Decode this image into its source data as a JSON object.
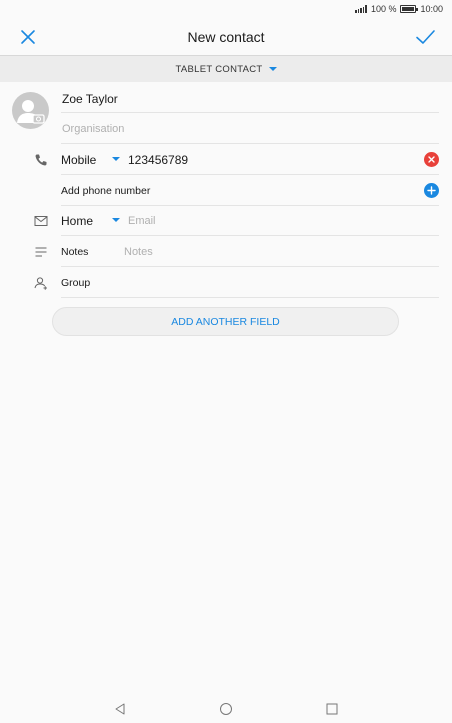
{
  "status_bar": {
    "battery": "100 %",
    "time": "10:00"
  },
  "app_bar": {
    "title": "New contact"
  },
  "account": {
    "label": "TABLET CONTACT"
  },
  "form": {
    "name": "Zoe Taylor",
    "organisation_placeholder": "Organisation",
    "phone": {
      "type": "Mobile",
      "value": "123456789"
    },
    "add_phone_label": "Add phone number",
    "email": {
      "type": "Home",
      "placeholder": "Email"
    },
    "notes": {
      "label": "Notes",
      "placeholder": "Notes"
    },
    "group_label": "Group",
    "add_field_button": "ADD ANOTHER FIELD"
  },
  "colors": {
    "accent": "#1a88e0",
    "remove": "#e8413a",
    "add": "#1a88e0"
  },
  "icons": [
    "close-icon",
    "check-icon",
    "camera-avatar-icon",
    "phone-icon",
    "mail-icon",
    "notes-icon",
    "group-icon",
    "remove-icon",
    "add-icon",
    "back-icon",
    "home-icon",
    "recents-icon"
  ]
}
